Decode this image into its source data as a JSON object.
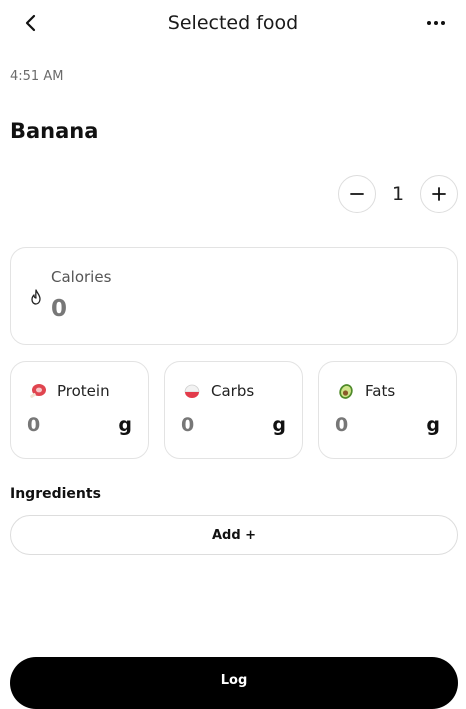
{
  "header": {
    "title": "Selected food",
    "back_icon": "chevron-left-icon",
    "more_icon": "more-horizontal-icon"
  },
  "entry": {
    "time": "4:51 AM",
    "food_name": "Banana"
  },
  "quantity": {
    "value": "1",
    "decrement_icon": "minus-icon",
    "increment_icon": "plus-icon"
  },
  "calories": {
    "label": "Calories",
    "value": "0",
    "icon": "flame-icon"
  },
  "macros": [
    {
      "label": "Protein",
      "value": "0",
      "unit": "g",
      "icon": "meat-icon",
      "color": "#e0454f"
    },
    {
      "label": "Carbs",
      "value": "0",
      "unit": "g",
      "icon": "rice-ball-icon",
      "color": "#e23b4b"
    },
    {
      "label": "Fats",
      "value": "0",
      "unit": "g",
      "icon": "avocado-icon",
      "color": "#7bb33a"
    }
  ],
  "ingredients": {
    "label": "Ingredients",
    "add_label": "Add +"
  },
  "footer": {
    "log_label": "Log"
  }
}
